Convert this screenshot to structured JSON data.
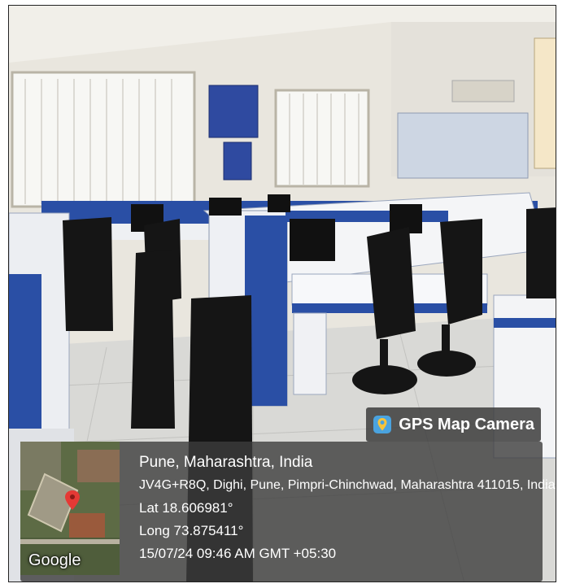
{
  "badge": {
    "label": "GPS Map Camera",
    "icon": "map-pin-camera-icon"
  },
  "info": {
    "place": "Pune, Maharashtra, India",
    "address": "JV4G+R8Q, Dighi, Pune, Pimpri-Chinchwad, Maharashtra 411015, India",
    "lat": "Lat 18.606981°",
    "long": "Long 73.875411°",
    "datetime": "15/07/24 09:46 AM GMT +05:30"
  },
  "map": {
    "brand": "Google"
  },
  "colors": {
    "workstation_blue": "#2a4fa5",
    "chair_black": "#151515",
    "overlay": "#3c3c3c",
    "pin_red": "#e53935"
  }
}
